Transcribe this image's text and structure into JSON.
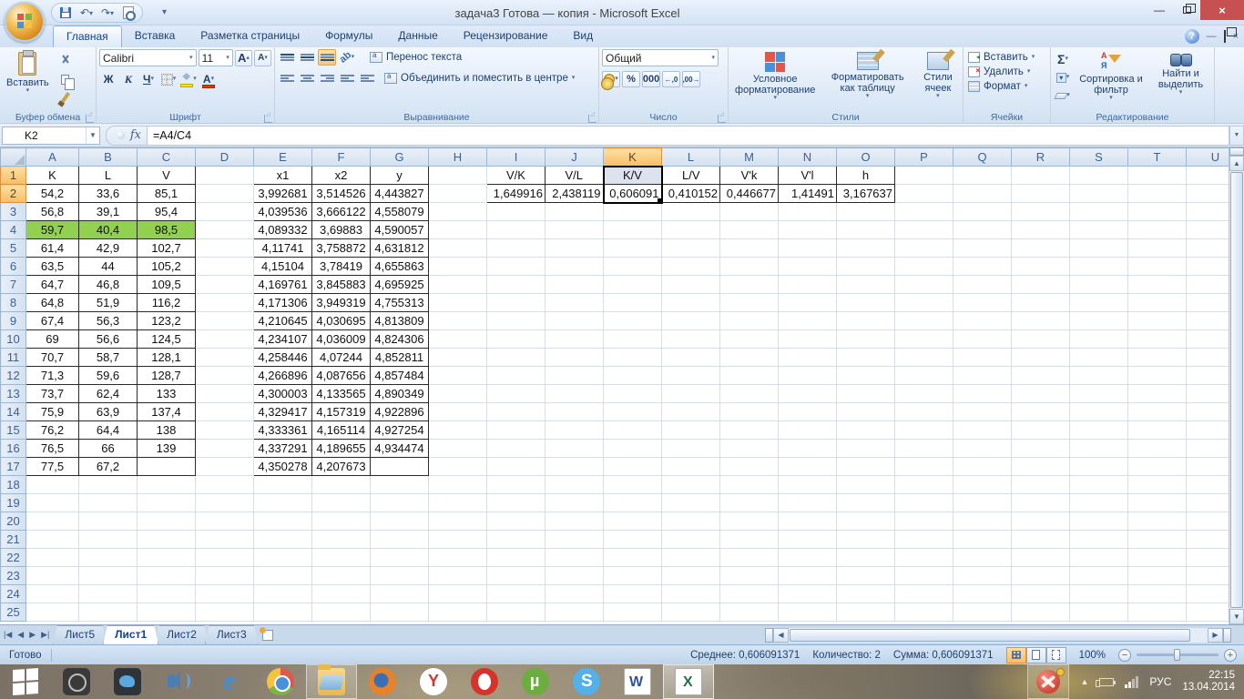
{
  "window": {
    "title": "задача3 Готова — копия - Microsoft Excel",
    "controls": {
      "minimize": "—",
      "restore": "restore",
      "close": "×"
    }
  },
  "ribbon": {
    "tabs": [
      {
        "label": "Главная",
        "active": true
      },
      {
        "label": "Вставка",
        "active": false
      },
      {
        "label": "Разметка страницы",
        "active": false
      },
      {
        "label": "Формулы",
        "active": false
      },
      {
        "label": "Данные",
        "active": false
      },
      {
        "label": "Рецензирование",
        "active": false
      },
      {
        "label": "Вид",
        "active": false
      }
    ],
    "clipboard": {
      "label": "Буфер обмена",
      "paste": "Вставить"
    },
    "font": {
      "label": "Шрифт",
      "font_name": "Calibri",
      "font_size": "11",
      "bold": "Ж",
      "italic": "К",
      "underline": "Ч",
      "grow": "А",
      "shrink": "А",
      "color_letter": "А"
    },
    "alignment": {
      "label": "Выравнивание",
      "wrap_text": "Перенос текста",
      "merge_center": "Объединить и поместить в центре",
      "orient": "ab"
    },
    "number": {
      "label": "Число",
      "format": "Общий",
      "percent": "%",
      "zeros": "000",
      "dec_inc": "←,0",
      "dec_dec": ",00→"
    },
    "styles": {
      "label": "Стили",
      "conditional": "Условное форматирование",
      "format_table": "Форматировать как таблицу",
      "cell_styles": "Стили ячеек"
    },
    "cells": {
      "label": "Ячейки",
      "insert": "Вставить",
      "delete": "Удалить",
      "format": "Формат"
    },
    "editing": {
      "label": "Редактирование",
      "sigma": "Σ",
      "sort_filter": "Сортировка и фильтр",
      "find_select": "Найти и выделить",
      "sort_a": "А",
      "sort_z": "Я"
    }
  },
  "formula_bar": {
    "name_box": "K2",
    "fx": "fx",
    "formula": "=A4/C4"
  },
  "grid": {
    "columns": [
      "A",
      "B",
      "C",
      "D",
      "E",
      "F",
      "G",
      "H",
      "I",
      "J",
      "K",
      "L",
      "M",
      "N",
      "O",
      "P",
      "Q",
      "R",
      "S",
      "T",
      "U"
    ],
    "row_count": 25,
    "selection": {
      "column": "K",
      "rows": [
        1,
        2
      ],
      "tint_cell": "K1",
      "active_cell": "K2"
    },
    "green": {
      "row": 4,
      "cols": [
        "A",
        "B",
        "C"
      ]
    },
    "tables": [
      {
        "origin_col": "A",
        "origin_row": 1,
        "align": "center",
        "headers": [
          "K",
          "L",
          "V"
        ],
        "rows": [
          [
            "54,2",
            "33,6",
            "85,1"
          ],
          [
            "56,8",
            "39,1",
            "95,4"
          ],
          [
            "59,7",
            "40,4",
            "98,5"
          ],
          [
            "61,4",
            "42,9",
            "102,7"
          ],
          [
            "63,5",
            "44",
            "105,2"
          ],
          [
            "64,7",
            "46,8",
            "109,5"
          ],
          [
            "64,8",
            "51,9",
            "116,2"
          ],
          [
            "67,4",
            "56,3",
            "123,2"
          ],
          [
            "69",
            "56,6",
            "124,5"
          ],
          [
            "70,7",
            "58,7",
            "128,1"
          ],
          [
            "71,3",
            "59,6",
            "128,7"
          ],
          [
            "73,7",
            "62,4",
            "133"
          ],
          [
            "75,9",
            "63,9",
            "137,4"
          ],
          [
            "76,2",
            "64,4",
            "138"
          ],
          [
            "76,5",
            "66",
            "139"
          ],
          [
            "77,5",
            "67,2",
            ""
          ]
        ]
      },
      {
        "origin_col": "E",
        "origin_row": 1,
        "align": "center",
        "headers": [
          "x1",
          "x2",
          "y"
        ],
        "rows": [
          [
            "3,992681",
            "3,514526",
            "4,443827"
          ],
          [
            "4,039536",
            "3,666122",
            "4,558079"
          ],
          [
            "4,089332",
            "3,69883",
            "4,590057"
          ],
          [
            "4,11741",
            "3,758872",
            "4,631812"
          ],
          [
            "4,15104",
            "3,78419",
            "4,655863"
          ],
          [
            "4,169761",
            "3,845883",
            "4,695925"
          ],
          [
            "4,171306",
            "3,949319",
            "4,755313"
          ],
          [
            "4,210645",
            "4,030695",
            "4,813809"
          ],
          [
            "4,234107",
            "4,036009",
            "4,824306"
          ],
          [
            "4,258446",
            "4,07244",
            "4,852811"
          ],
          [
            "4,266896",
            "4,087656",
            "4,857484"
          ],
          [
            "4,300003",
            "4,133565",
            "4,890349"
          ],
          [
            "4,329417",
            "4,157319",
            "4,922896"
          ],
          [
            "4,333361",
            "4,165114",
            "4,927254"
          ],
          [
            "4,337291",
            "4,189655",
            "4,934474"
          ],
          [
            "4,350278",
            "4,207673",
            ""
          ]
        ]
      },
      {
        "origin_col": "I",
        "origin_row": 1,
        "align": "right",
        "headers": [
          "V/K",
          "V/L",
          "K/V",
          "L/V",
          "V'k",
          "V'l",
          "h"
        ],
        "rows": [
          [
            "1,649916",
            "2,438119",
            "0,606091",
            "0,410152",
            "0,446677",
            "1,41491",
            "3,167637"
          ]
        ]
      }
    ]
  },
  "sheet_tabs": {
    "tabs": [
      {
        "label": "Лист5",
        "active": false
      },
      {
        "label": "Лист1",
        "active": true
      },
      {
        "label": "Лист2",
        "active": false
      },
      {
        "label": "Лист3",
        "active": false
      }
    ]
  },
  "status_bar": {
    "ready": "Готово",
    "average": "Среднее: 0,606091371",
    "count": "Количество: 2",
    "sum": "Сумма: 0,606091371",
    "zoom": "100%"
  },
  "taskbar": {
    "icons": [
      {
        "name": "start",
        "open": false,
        "active": false
      },
      {
        "name": "darkapp",
        "open": false,
        "active": false
      },
      {
        "name": "twitter",
        "open": false,
        "active": false
      },
      {
        "name": "volume",
        "open": false,
        "active": false
      },
      {
        "name": "ie",
        "open": false,
        "active": false
      },
      {
        "name": "chrome",
        "open": false,
        "active": false
      },
      {
        "name": "folder",
        "open": true,
        "active": false
      },
      {
        "name": "firefox",
        "open": false,
        "active": false
      },
      {
        "name": "yandex",
        "open": false,
        "active": false
      },
      {
        "name": "opera",
        "open": false,
        "active": false
      },
      {
        "name": "utorrent",
        "open": false,
        "active": false
      },
      {
        "name": "skype",
        "open": false,
        "active": false
      },
      {
        "name": "word",
        "open": false,
        "active": false
      },
      {
        "name": "excel",
        "open": true,
        "active": true
      }
    ],
    "tray": {
      "lang": "РУС",
      "time": "22:15",
      "date": "13.04.2014"
    }
  }
}
